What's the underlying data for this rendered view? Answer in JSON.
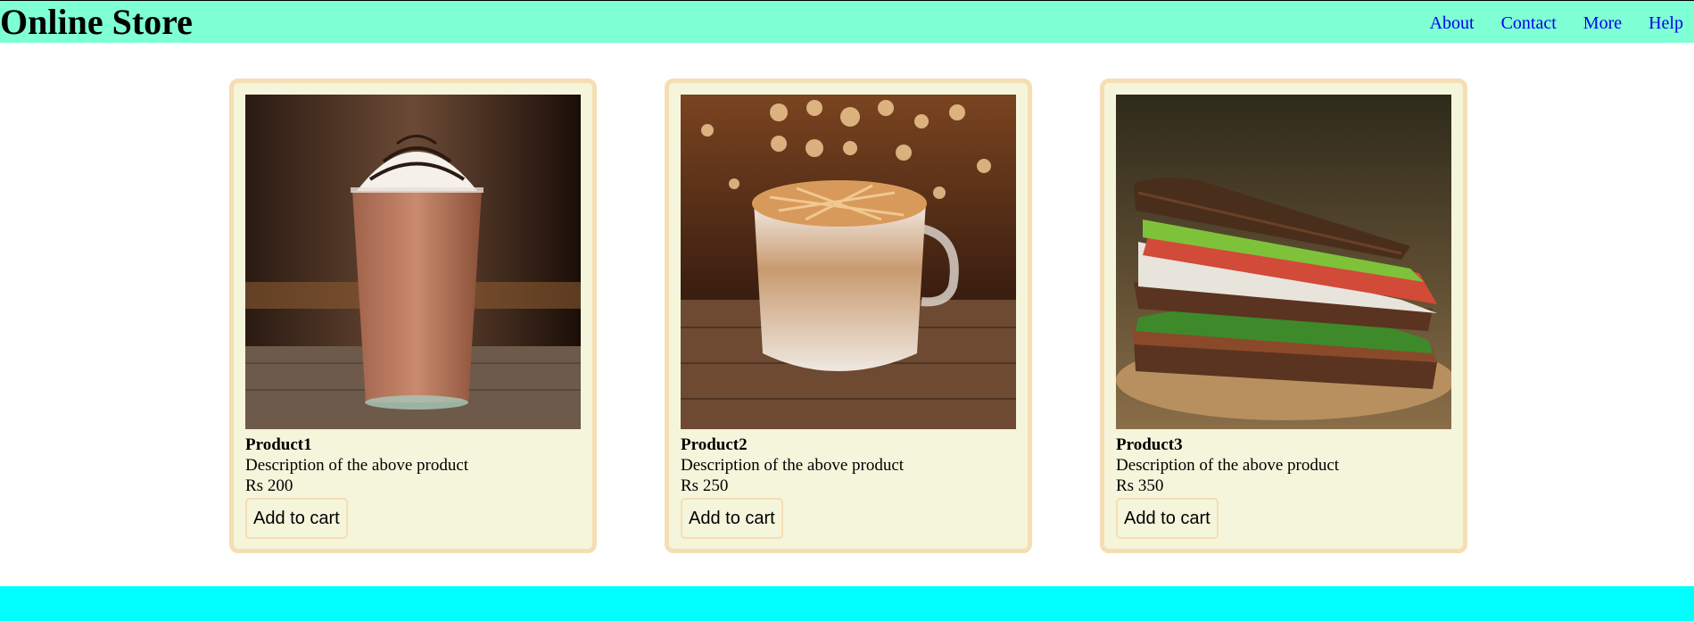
{
  "header": {
    "title": "Online Store",
    "nav": [
      "About",
      "Contact",
      "More",
      "Help"
    ]
  },
  "products": [
    {
      "name": "Product1",
      "description": "Description of the above product",
      "price": "Rs 200",
      "button": "Add to cart",
      "image": "frappe-drink"
    },
    {
      "name": "Product2",
      "description": "Description of the above product",
      "price": "Rs 250",
      "button": "Add to cart",
      "image": "latte-cup"
    },
    {
      "name": "Product3",
      "description": "Description of the above product",
      "price": "Rs 350",
      "button": "Add to cart",
      "image": "sandwich"
    }
  ],
  "colors": {
    "header_bg": "#7fffd4",
    "footer_bg": "#00ffff",
    "card_bg": "#f5f5dc",
    "card_border": "#f5deb3",
    "link": "#0000ee"
  }
}
